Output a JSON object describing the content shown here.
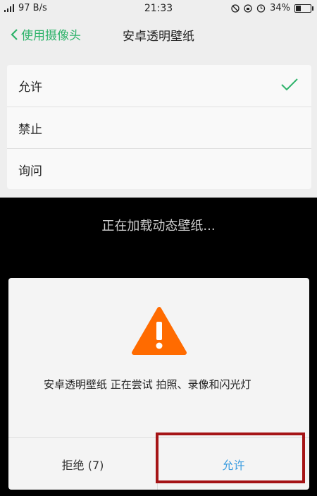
{
  "status_bar": {
    "network": "97 B/s",
    "time": "21:33",
    "battery_percent": "34%",
    "battery_level": 0.34
  },
  "nav": {
    "back_label": "使用摄像头",
    "title": "安卓透明壁纸"
  },
  "options": [
    {
      "label": "允许",
      "selected": true
    },
    {
      "label": "禁止",
      "selected": false
    },
    {
      "label": "询问",
      "selected": false
    }
  ],
  "loading_text": "正在加载动态壁纸...",
  "dialog": {
    "message": "安卓透明壁纸 正在尝试 拍照、录像和闪光灯",
    "deny_label": "拒绝 (7)",
    "allow_label": "允许"
  },
  "colors": {
    "accent": "#2fb36b",
    "warning": "#ff6b00",
    "allow": "#3b9de0",
    "highlight": "#a51416"
  }
}
